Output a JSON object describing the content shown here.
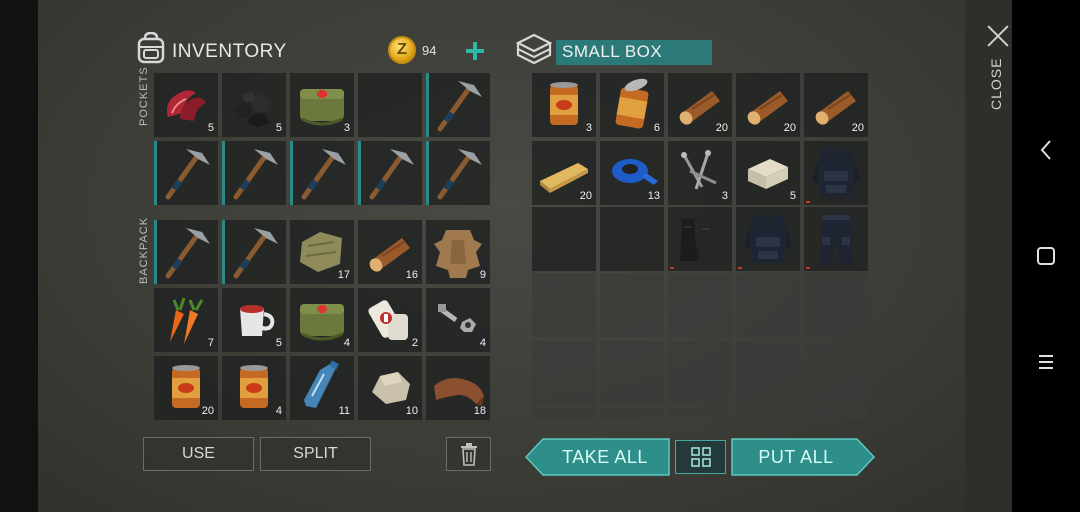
{
  "inventory": {
    "title": "INVENTORY",
    "currency": {
      "symbol": "Z",
      "amount": "94"
    },
    "pockets_label": "POCKETS",
    "backpack_label": "BACKPACK",
    "pockets": [
      {
        "item": "raw-meat",
        "count": "5"
      },
      {
        "item": "coal",
        "count": "5"
      },
      {
        "item": "medkit-bag",
        "count": "3"
      },
      {
        "item": "empty",
        "count": ""
      },
      {
        "item": "pickaxe",
        "count": ""
      },
      {
        "item": "pickaxe",
        "count": ""
      },
      {
        "item": "pickaxe",
        "count": ""
      },
      {
        "item": "pickaxe",
        "count": ""
      },
      {
        "item": "pickaxe",
        "count": ""
      },
      {
        "item": "pickaxe",
        "count": ""
      }
    ],
    "backpack": [
      {
        "item": "pickaxe",
        "count": ""
      },
      {
        "item": "pickaxe",
        "count": ""
      },
      {
        "item": "cloth",
        "count": "17"
      },
      {
        "item": "log",
        "count": "16"
      },
      {
        "item": "animal-hide",
        "count": "9"
      },
      {
        "item": "carrots",
        "count": "7"
      },
      {
        "item": "tea-mug",
        "count": "5"
      },
      {
        "item": "medkit-bag",
        "count": "4"
      },
      {
        "item": "bandage",
        "count": "2"
      },
      {
        "item": "bolts",
        "count": "4"
      },
      {
        "item": "food-can",
        "count": "20"
      },
      {
        "item": "food-can",
        "count": "4"
      },
      {
        "item": "water-bottle",
        "count": "11"
      },
      {
        "item": "stone",
        "count": "10"
      },
      {
        "item": "leather",
        "count": "18"
      }
    ],
    "use_label": "USE",
    "split_label": "SPLIT"
  },
  "box": {
    "title": "SMALL BOX",
    "items": [
      {
        "item": "food-can",
        "count": "3"
      },
      {
        "item": "open-can",
        "count": "6"
      },
      {
        "item": "log",
        "count": "20"
      },
      {
        "item": "log",
        "count": "20"
      },
      {
        "item": "log",
        "count": "20"
      },
      {
        "item": "plank",
        "count": "20"
      },
      {
        "item": "duct-tape",
        "count": "13"
      },
      {
        "item": "nails",
        "count": "3"
      },
      {
        "item": "stone-block",
        "count": "5"
      },
      {
        "item": "police-vest",
        "count": ""
      },
      {
        "item": "empty",
        "count": ""
      },
      {
        "item": "empty",
        "count": ""
      },
      {
        "item": "boots",
        "count": ""
      },
      {
        "item": "police-vest",
        "count": ""
      },
      {
        "item": "police-pants",
        "count": ""
      }
    ],
    "take_all_label": "TAKE ALL",
    "put_all_label": "PUT ALL"
  },
  "close_label": "CLOSE",
  "colors": {
    "accent": "#2c8c88",
    "coin": "#e0a818"
  }
}
